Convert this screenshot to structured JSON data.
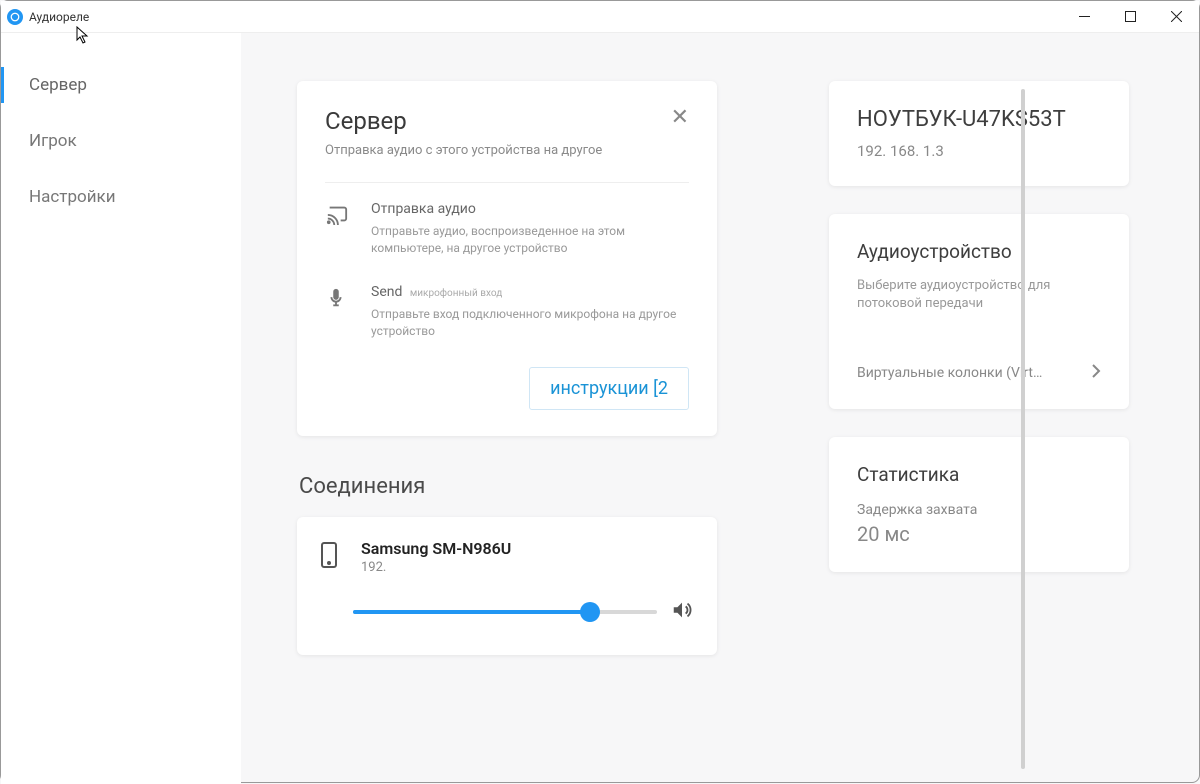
{
  "window": {
    "title": "Аудиореле"
  },
  "sidebar": {
    "items": [
      {
        "label": "Сервер"
      },
      {
        "label": "Игрок"
      },
      {
        "label": "Настройки"
      }
    ]
  },
  "server_card": {
    "title": "Сервер",
    "subtitle": "Отправка аудио с этого устройства на другое",
    "option1": {
      "title": "Отправка аудио",
      "desc": "Отправьте аудио, воспроизведенное на этом компьютере, на другое устройство"
    },
    "option2": {
      "title": "Send",
      "title_sub": "микрофонный вход",
      "desc": "Отправьте вход подключенного микрофона на другое устройство"
    },
    "instructions": "инструкции [2"
  },
  "connections": {
    "heading": "Соединения",
    "device": {
      "name": "Samsung SM-N986U",
      "ip": "192."
    }
  },
  "right": {
    "host": {
      "name": "НОУТБУК-U47KS53T",
      "ip": "192. 168. 1.3"
    },
    "audio_device": {
      "title": "Аудиоустройство",
      "desc": "Выберите аудиоустройство для потоковой передачи",
      "picker_label": "Виртуальные колонки (Virtua…"
    },
    "stats": {
      "title": "Статистика",
      "latency_label": "Задержка захвата",
      "latency_value": "20 мс"
    }
  }
}
